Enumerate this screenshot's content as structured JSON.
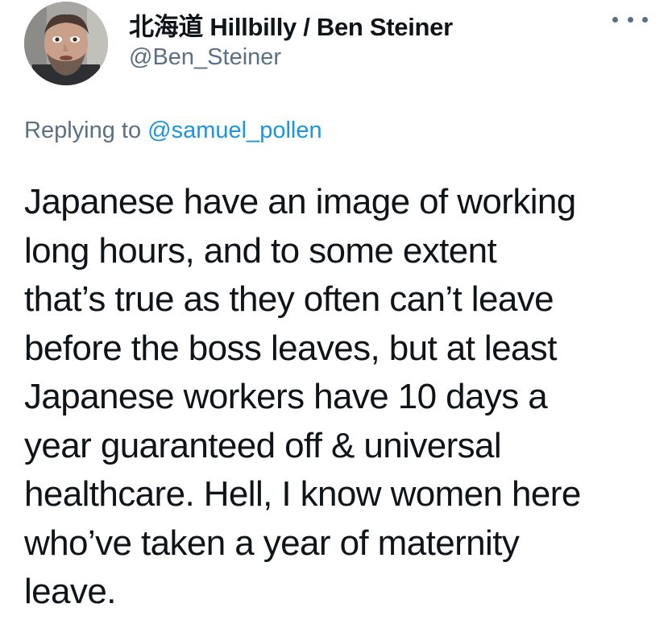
{
  "tweet": {
    "author_name": "北海道 Hillbilly / Ben Steiner",
    "author_handle": "@Ben_Steiner",
    "more_icon": "more-horizontal-icon",
    "reply_prefix": "Replying to",
    "reply_mention": "@samuel_pollen",
    "body_lines": [
      "Japanese have an image of working",
      "long hours, and to some extent",
      "that’s true as they often can’t leave",
      "before the boss leaves, but at least",
      "Japanese workers have 10 days a",
      "year guaranteed off & universal",
      "healthcare. Hell, I know women here",
      "who’ve taken a year of maternity",
      "leave."
    ]
  },
  "colors": {
    "text_primary": "#0f1419",
    "text_secondary": "#5b7083",
    "link": "#1b95e0",
    "background": "#ffffff"
  }
}
